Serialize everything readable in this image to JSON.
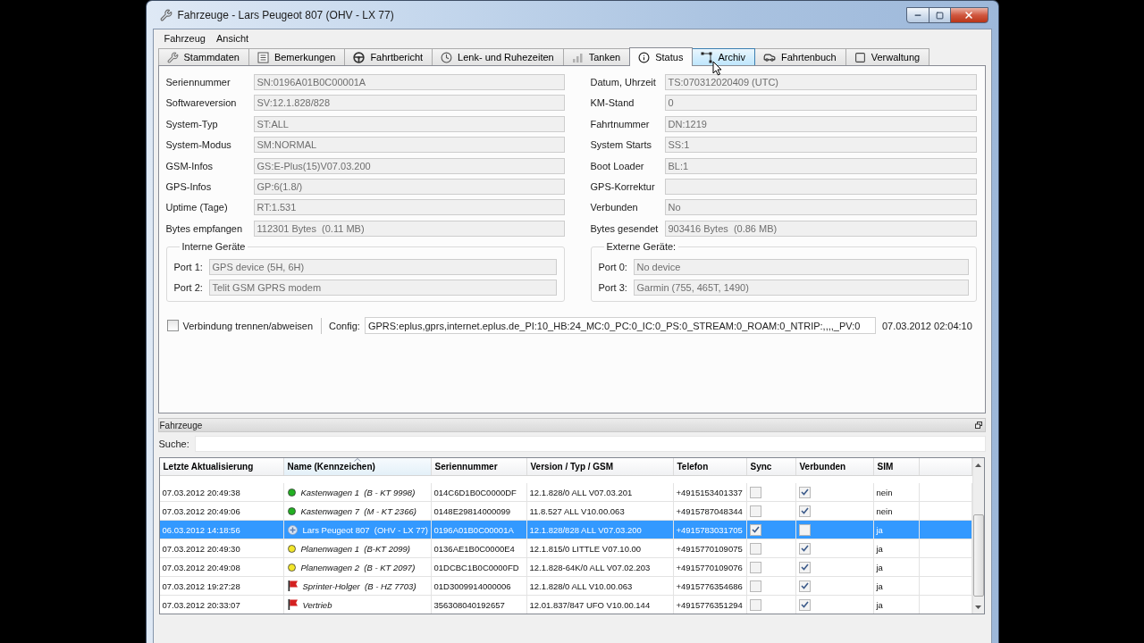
{
  "window": {
    "title": "Fahrzeuge - Lars Peugeot 807 (OHV - LX 77)"
  },
  "menu": [
    "Fahrzeug",
    "Ansicht"
  ],
  "tabs": [
    {
      "label": "Stammdaten",
      "selected": false,
      "hovered": false
    },
    {
      "label": "Bemerkungen",
      "selected": false,
      "hovered": false
    },
    {
      "label": "Fahrtbericht",
      "selected": false,
      "hovered": false
    },
    {
      "label": "Lenk- und Ruhezeiten",
      "selected": false,
      "hovered": false
    },
    {
      "label": "Tanken",
      "selected": false,
      "hovered": false
    },
    {
      "label": "Status",
      "selected": true,
      "hovered": false
    },
    {
      "label": "Archiv",
      "selected": false,
      "hovered": true
    },
    {
      "label": "Fahrtenbuch",
      "selected": false,
      "hovered": false
    },
    {
      "label": "Verwaltung",
      "selected": false,
      "hovered": false
    }
  ],
  "status": {
    "left_fields": [
      {
        "label": "Seriennummer",
        "value": "SN:0196A01B0C00001A"
      },
      {
        "label": "Softwareversion",
        "value": "SV:12.1.828/828"
      },
      {
        "label": "System-Typ",
        "value": "ST:ALL"
      },
      {
        "label": "System-Modus",
        "value": "SM:NORMAL"
      },
      {
        "label": "GSM-Infos",
        "value": "GS:E-Plus(15)V07.03.200"
      },
      {
        "label": "GPS-Infos",
        "value": "GP:6(1.8/)"
      },
      {
        "label": "Uptime (Tage)",
        "value": "RT:1.531"
      },
      {
        "label": "Bytes empfangen",
        "value": "112301 Bytes  (0.11 MB)"
      }
    ],
    "right_fields": [
      {
        "label": "Datum, Uhrzeit",
        "value": "TS:070312020409 (UTC)"
      },
      {
        "label": "KM-Stand",
        "value": "0"
      },
      {
        "label": "Fahrtnummer",
        "value": "DN:1219"
      },
      {
        "label": "System Starts",
        "value": "SS:1"
      },
      {
        "label": "Boot Loader",
        "value": "BL:1"
      },
      {
        "label": "GPS-Korrektur"
      },
      {
        "label": "Verbunden",
        "value": "No"
      },
      {
        "label": "Bytes gesendet",
        "value": "903416 Bytes  (0.86 MB)"
      }
    ],
    "internal_devices": {
      "title": "Interne Geräte",
      "ports": [
        {
          "label": "Port 1:",
          "value": "GPS device (5H, 6H)"
        },
        {
          "label": "Port 2:",
          "value": "Telit GSM GPRS modem"
        }
      ]
    },
    "external_devices": {
      "title": "Externe Geräte:",
      "ports": [
        {
          "label": "Port 0:",
          "value": "No device"
        },
        {
          "label": "Port 3:",
          "value": "Garmin (755, 465T, 1490)"
        }
      ]
    },
    "disconnect": {
      "label": "Verbindung trennen/abweisen",
      "checked": false
    },
    "config": {
      "label": "Config:",
      "value": "GPRS:eplus,gprs,internet.eplus.de_PI:10_HB:24_MC:0_PC:0_IC:0_PS:0_STREAM:0_ROAM:0_NTRIP:,,,,_PV:0"
    },
    "timestamp": "07.03.2012 02:04:10"
  },
  "vehicles": {
    "title": "Fahrzeuge",
    "search": {
      "label": "Suche:"
    },
    "columns": [
      {
        "label": "Letzte Aktualisierung",
        "sorted": false
      },
      {
        "label": "Name (Kennzeichen)",
        "sorted": true
      },
      {
        "label": "Seriennummer",
        "sorted": false
      },
      {
        "label": "Version / Typ / GSM",
        "sorted": false
      },
      {
        "label": "Telefon",
        "sorted": false
      },
      {
        "label": "Sync",
        "sorted": false
      },
      {
        "label": "Verbunden",
        "sorted": false
      },
      {
        "label": "SIM",
        "sorted": false
      }
    ],
    "rows": [
      {
        "updated": "07.03.2012 20:49:38",
        "marker": {
          "kind": "dot",
          "color": "#22b022"
        },
        "name": "Kastenwagen 1  (B - KT 9998)",
        "serial": "014C6D1B0C0000DF",
        "version": "12.1.828/0 ALL V07.03.201",
        "phone": "+4915153401337",
        "sync": false,
        "connected": true,
        "sim": "nein",
        "selected": false
      },
      {
        "updated": "07.03.2012 20:49:06",
        "marker": {
          "kind": "dot",
          "color": "#22b022"
        },
        "name": "Kastenwagen 7  (M - KT 2366)",
        "serial": "0148E29814000099",
        "version": "11.8.527 ALL V10.00.063",
        "phone": "+4915787048344",
        "sync": false,
        "connected": true,
        "sim": "nein",
        "selected": false
      },
      {
        "updated": "06.03.2012 14:18:56",
        "marker": {
          "kind": "plus"
        },
        "name": "Lars Peugeot 807  (OHV - LX 77)",
        "serial": "0196A01B0C00001A",
        "version": "12.1.828/828 ALL V07.03.200",
        "phone": "+4915783031705",
        "sync": true,
        "connected": false,
        "sim": "ja",
        "selected": true
      },
      {
        "updated": "07.03.2012 20:49:30",
        "marker": {
          "kind": "dot",
          "color": "#f2e62a"
        },
        "name": "Planenwagen 1  (B-KT 2099)",
        "serial": "0136AE1B0C0000E4",
        "version": "12.1.815/0 LITTLE V07.10.00",
        "phone": "+4915770109075",
        "sync": false,
        "connected": true,
        "sim": "ja",
        "selected": false
      },
      {
        "updated": "07.03.2012 20:49:08",
        "marker": {
          "kind": "dot",
          "color": "#f2e62a"
        },
        "name": "Planenwagen 2  (B - KT 2097)",
        "serial": "01DCBC1B0C0000FD",
        "version": "12.1.828-64K/0 ALL V07.02.203",
        "phone": "+4915770109076",
        "sync": false,
        "connected": true,
        "sim": "ja",
        "selected": false
      },
      {
        "updated": "07.03.2012 19:27:28",
        "marker": {
          "kind": "flag",
          "color": "#d42020"
        },
        "name": "Sprinter-Holger  (B - HZ 7703)",
        "serial": "01D3009914000006",
        "version": "12.1.828/0 ALL V10.00.063",
        "phone": "+4915776354686",
        "sync": false,
        "connected": true,
        "sim": "ja",
        "selected": false
      },
      {
        "updated": "07.03.2012 20:33:07",
        "marker": {
          "kind": "flag",
          "color": "#d42020"
        },
        "name": "Vertrieb",
        "serial": "356308040192657",
        "version": "12.01.837/847 UFO V10.00.144",
        "phone": "+4915776351294",
        "sync": false,
        "connected": true,
        "sim": "ja",
        "selected": false
      }
    ]
  }
}
